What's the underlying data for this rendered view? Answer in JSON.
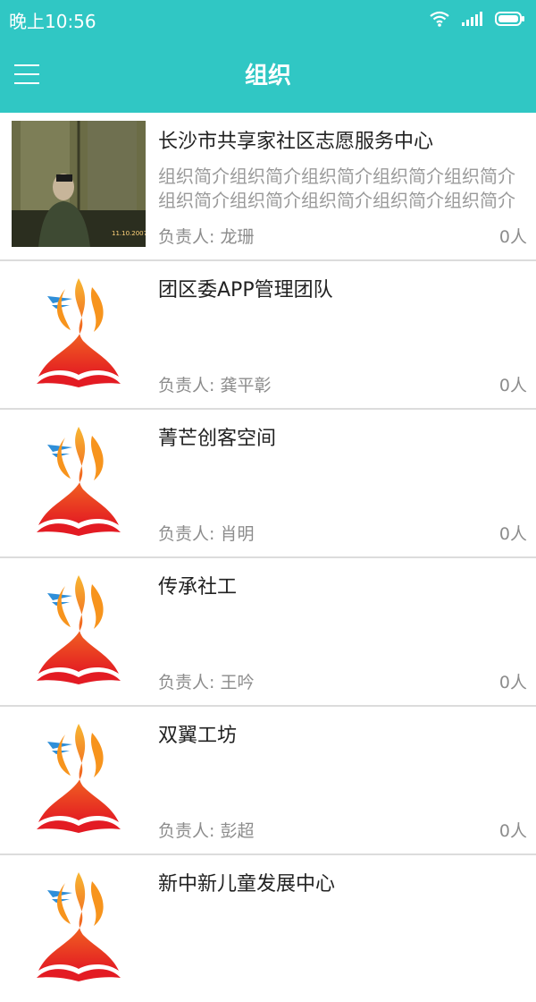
{
  "status": {
    "time": "晚上10:56"
  },
  "header": {
    "title": "组织"
  },
  "orgs": [
    {
      "name": "长沙市共享家社区志愿服务中心",
      "intro": "组织简介组织简介组织简介组织简介组织简介组织简介组织简介组织简介组织简介组织简介",
      "leader": "负责人: 龙珊",
      "count": "0人",
      "image": "photo"
    },
    {
      "name": "团区委APP管理团队",
      "intro": "",
      "leader": "负责人: 龚平彰",
      "count": "0人",
      "image": "flame-logo"
    },
    {
      "name": "菁芒创客空间",
      "intro": "",
      "leader": "负责人: 肖明",
      "count": "0人",
      "image": "flame-logo"
    },
    {
      "name": "传承社工",
      "intro": "",
      "leader": "负责人: 王吟",
      "count": "0人",
      "image": "flame-logo"
    },
    {
      "name": "双翼工坊",
      "intro": "",
      "leader": "负责人: 彭超",
      "count": "0人",
      "image": "flame-logo"
    },
    {
      "name": "新中新儿童发展中心",
      "intro": "",
      "leader": "",
      "count": "",
      "image": "flame-logo"
    }
  ],
  "colors": {
    "accent": "#30c7c4"
  }
}
